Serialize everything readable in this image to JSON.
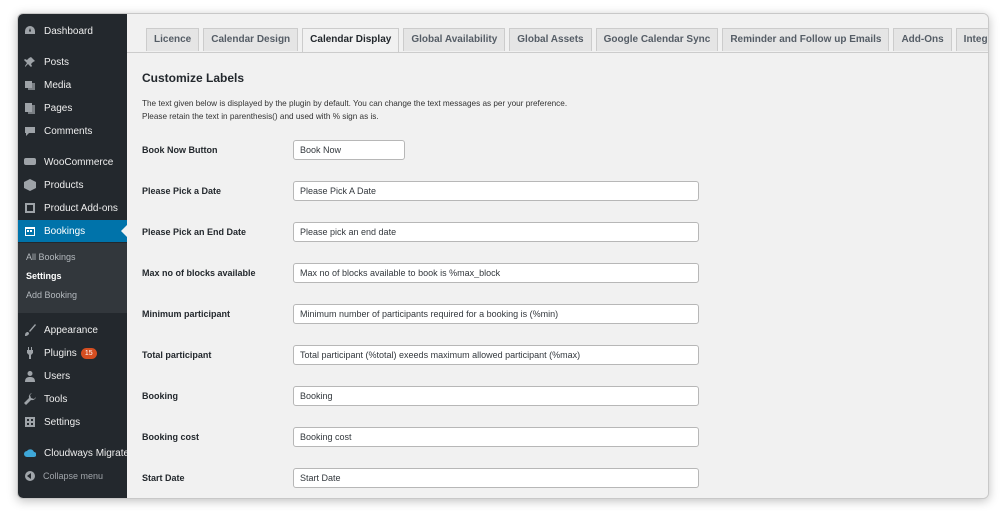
{
  "sidebar": {
    "items": [
      {
        "label": "Dashboard",
        "icon": "dashboard-icon"
      },
      {
        "label": "Posts",
        "icon": "pin-icon"
      },
      {
        "label": "Media",
        "icon": "media-icon"
      },
      {
        "label": "Pages",
        "icon": "pages-icon"
      },
      {
        "label": "Comments",
        "icon": "comments-icon"
      },
      {
        "label": "WooCommerce",
        "icon": "woocommerce-icon"
      },
      {
        "label": "Products",
        "icon": "products-icon"
      },
      {
        "label": "Product Add-ons",
        "icon": "addons-icon"
      },
      {
        "label": "Bookings",
        "icon": "calendar-icon",
        "active": true
      },
      {
        "label": "Appearance",
        "icon": "brush-icon"
      },
      {
        "label": "Plugins",
        "icon": "plugin-icon",
        "badge": "15"
      },
      {
        "label": "Users",
        "icon": "users-icon"
      },
      {
        "label": "Tools",
        "icon": "wrench-icon"
      },
      {
        "label": "Settings",
        "icon": "settings-icon"
      },
      {
        "label": "Cloudways Migrate",
        "icon": "cloud-icon"
      }
    ],
    "submenu": [
      {
        "label": "All Bookings"
      },
      {
        "label": "Settings",
        "current": true
      },
      {
        "label": "Add Booking"
      }
    ],
    "collapse_label": "Collapse menu"
  },
  "tabs": [
    {
      "label": "Licence"
    },
    {
      "label": "Calendar Design"
    },
    {
      "label": "Calendar Display",
      "active": true
    },
    {
      "label": "Global Availability"
    },
    {
      "label": "Global Assets"
    },
    {
      "label": "Google Calendar Sync"
    },
    {
      "label": "Reminder and Follow up Emails"
    },
    {
      "label": "Add-Ons"
    },
    {
      "label": "Integrations"
    }
  ],
  "content": {
    "title": "Customize Labels",
    "description_line1": "The text given below is displayed by the plugin by default. You can change the text messages as per your preference.",
    "description_line2": "Please retain the text in parenthesis() and used with % sign as is.",
    "fields": [
      {
        "label": "Book Now Button",
        "value": "Book Now"
      },
      {
        "label": "Please Pick a Date",
        "value": "Please Pick A Date"
      },
      {
        "label": "Please Pick an End Date",
        "value": "Please pick an end date"
      },
      {
        "label": "Max no of blocks available",
        "value": "Max no of blocks available to book is %max_block"
      },
      {
        "label": "Minimum participant",
        "value": "Minimum number of participants required for a booking is (%min)"
      },
      {
        "label": "Total participant",
        "value": "Total participant (%total) exeeds maximum allowed participant (%max)"
      },
      {
        "label": "Booking",
        "value": "Booking"
      },
      {
        "label": "Booking cost",
        "value": "Booking cost"
      },
      {
        "label": "Start Date",
        "value": "Start Date"
      }
    ]
  },
  "colors": {
    "sidebar_bg": "#23282d",
    "active_menu": "#0073aa",
    "content_bg": "#f1f1f1",
    "badge": "#d54e21"
  }
}
